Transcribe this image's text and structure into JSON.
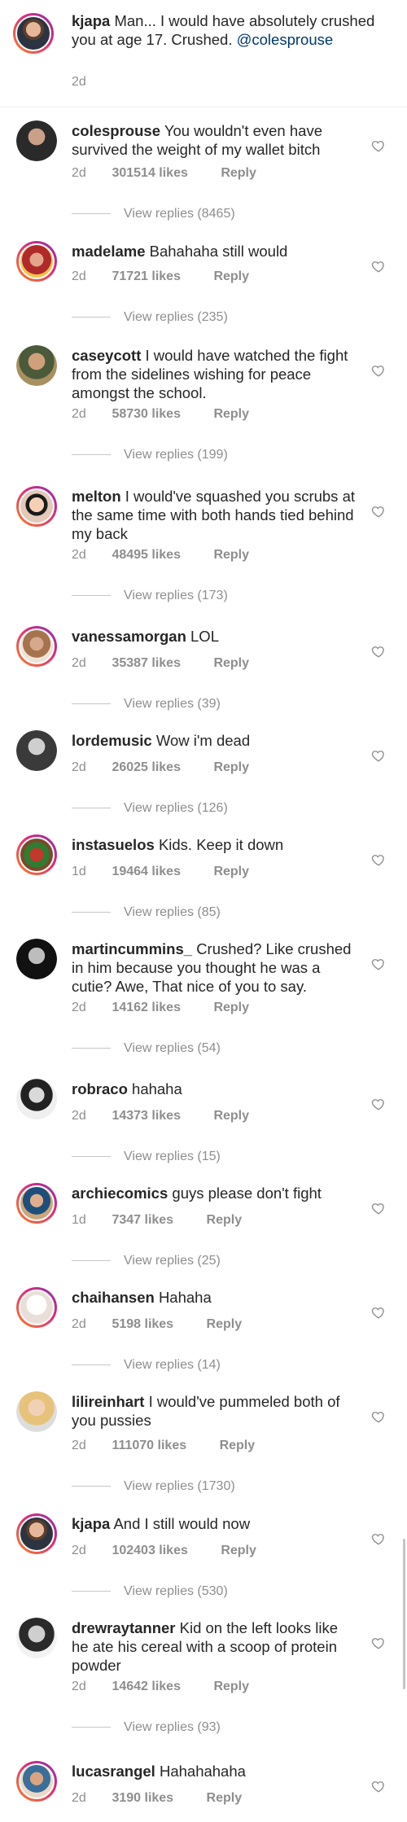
{
  "caption": {
    "username": "kjapa",
    "text": "Man... I would have absolutely crushed you at age 17. Crushed.",
    "mention": "@colesprouse",
    "time": "2d"
  },
  "comments": [
    {
      "username": "colesprouse",
      "text": "You wouldn't even have survived the weight of my wallet bitch",
      "time": "2d",
      "likes": "301514 likes",
      "reply": "Reply",
      "replies": "View replies (8465)"
    },
    {
      "username": "madelame",
      "text": "Bahahaha still would",
      "time": "2d",
      "likes": "71721 likes",
      "reply": "Reply",
      "replies": "View replies (235)"
    },
    {
      "username": "caseycott",
      "text": "I would have watched the fight from the sidelines wishing for peace amongst the school.",
      "time": "2d",
      "likes": "58730 likes",
      "reply": "Reply",
      "replies": "View replies (199)"
    },
    {
      "username": "melton",
      "text": "I would've squashed you scrubs at the same time with both hands tied behind my back",
      "time": "2d",
      "likes": "48495 likes",
      "reply": "Reply",
      "replies": "View replies (173)"
    },
    {
      "username": "vanessamorgan",
      "text": "LOL",
      "time": "2d",
      "likes": "35387 likes",
      "reply": "Reply",
      "replies": "View replies (39)"
    },
    {
      "username": "lordemusic",
      "text": "Wow i'm dead",
      "time": "2d",
      "likes": "26025 likes",
      "reply": "Reply",
      "replies": "View replies (126)"
    },
    {
      "username": "instasuelos",
      "text": "Kids. Keep it down",
      "time": "1d",
      "likes": "19464 likes",
      "reply": "Reply",
      "replies": "View replies (85)"
    },
    {
      "username": "martincummins_",
      "text": "Crushed? Like crushed in him because you thought he was a cutie? Awe, That nice of you to say.",
      "time": "2d",
      "likes": "14162 likes",
      "reply": "Reply",
      "replies": "View replies (54)"
    },
    {
      "username": "robraco",
      "text": "hahaha",
      "time": "2d",
      "likes": "14373 likes",
      "reply": "Reply",
      "replies": "View replies (15)"
    },
    {
      "username": "archiecomics",
      "text": "guys please don't fight",
      "time": "1d",
      "likes": "7347 likes",
      "reply": "Reply",
      "replies": "View replies (25)"
    },
    {
      "username": "chaihansen",
      "text": "Hahaha",
      "time": "2d",
      "likes": "5198 likes",
      "reply": "Reply",
      "replies": "View replies (14)"
    },
    {
      "username": "lilireinhart",
      "text": "I would've pummeled both of you pussies",
      "time": "2d",
      "likes": "111070 likes",
      "reply": "Reply",
      "replies": "View replies (1730)"
    },
    {
      "username": "kjapa",
      "text": "And I still would now",
      "time": "2d",
      "likes": "102403 likes",
      "reply": "Reply",
      "replies": "View replies (530)"
    },
    {
      "username": "drewraytanner",
      "text": "Kid on the left looks like he ate his cereal with a scoop of protein powder",
      "time": "2d",
      "likes": "14642 likes",
      "reply": "Reply",
      "replies": "View replies (93)"
    },
    {
      "username": "lucasrangel",
      "text": "Hahahahaha",
      "time": "2d",
      "likes": "3190 likes",
      "reply": "Reply",
      "replies": ""
    }
  ],
  "icons": {
    "like": "heart-outline-icon"
  },
  "colors": {
    "meta": "#8e8e8e",
    "mention": "#00376b",
    "ring_start": "#f58529",
    "ring_end": "#8134af"
  }
}
